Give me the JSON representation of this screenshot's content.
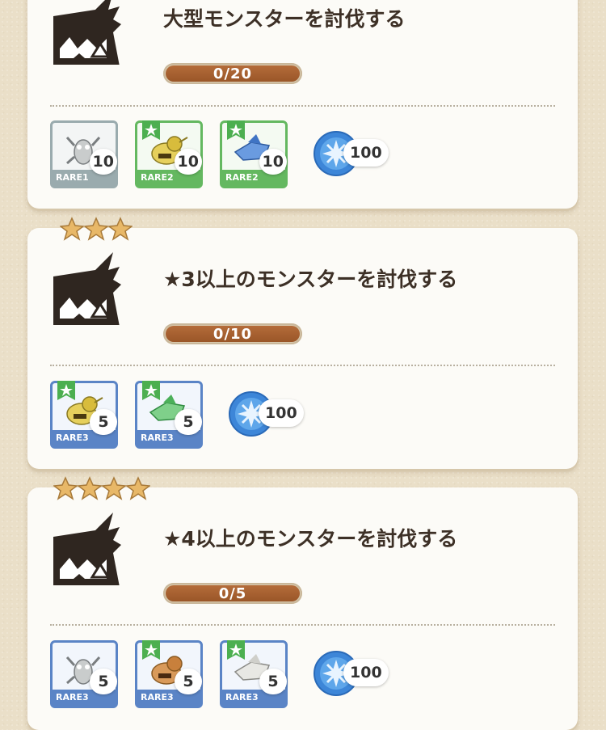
{
  "quests": [
    {
      "stars": 0,
      "title": "大型モンスターを討伐する",
      "progress": "0/20",
      "progress_fraction": 0,
      "rewards": [
        {
          "rare": "RARE1",
          "count": "10",
          "flag": false,
          "icon": "gray-bug-monster-icon"
        },
        {
          "rare": "RARE2",
          "count": "10",
          "flag": true,
          "icon": "yellow-snail-monster-icon"
        },
        {
          "rare": "RARE2",
          "count": "10",
          "flag": true,
          "icon": "blue-wing-monster-icon"
        }
      ],
      "orb": {
        "count": "100",
        "icon": "blue-crystal-orb-icon"
      }
    },
    {
      "stars": 3,
      "title": "★3以上のモンスターを討伐する",
      "progress": "0/10",
      "progress_fraction": 0,
      "rewards": [
        {
          "rare": "RARE3",
          "count": "5",
          "flag": true,
          "icon": "yellow-snail-monster-icon"
        },
        {
          "rare": "RARE3",
          "count": "5",
          "flag": true,
          "icon": "green-wing-monster-icon"
        }
      ],
      "orb": {
        "count": "100",
        "icon": "blue-crystal-orb-icon"
      }
    },
    {
      "stars": 4,
      "title": "★4以上のモンスターを討伐する",
      "progress": "0/5",
      "progress_fraction": 0,
      "rewards": [
        {
          "rare": "RARE3",
          "count": "5",
          "flag": false,
          "icon": "gray-bug-monster-icon"
        },
        {
          "rare": "RARE3",
          "count": "5",
          "flag": true,
          "icon": "orange-snail-monster-icon"
        },
        {
          "rare": "RARE3",
          "count": "5",
          "flag": true,
          "icon": "white-wing-monster-icon"
        }
      ],
      "orb": {
        "count": "100",
        "icon": "blue-crystal-orb-icon"
      }
    }
  ],
  "colors": {
    "progress_fill": "#a9602f",
    "rare1": "#9aabae",
    "rare2": "#64b860",
    "rare3": "#5a84c6",
    "star": "#e8b868"
  }
}
